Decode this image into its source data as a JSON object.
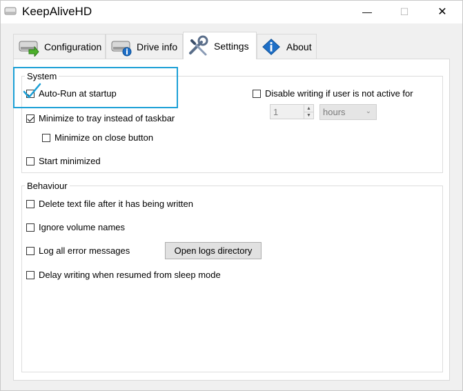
{
  "window": {
    "title": "KeepAliveHD"
  },
  "titlebar": {
    "minimize": "—",
    "maximize": "☐",
    "close": "✕"
  },
  "tabs": [
    {
      "label": "Configuration",
      "icon": "drive-arrow-icon",
      "active": false
    },
    {
      "label": "Drive info",
      "icon": "drive-info-icon",
      "active": false
    },
    {
      "label": "Settings",
      "icon": "wrench-screwdriver-icon",
      "active": true
    },
    {
      "label": "About",
      "icon": "info-icon",
      "active": false
    }
  ],
  "system": {
    "legend": "System",
    "autorun": {
      "label": "Auto-Run at startup",
      "checked": true
    },
    "minimize_tray": {
      "label": "Minimize to tray instead of taskbar",
      "checked": true
    },
    "minimize_close": {
      "label": "Minimize on close button",
      "checked": false
    },
    "start_minimized": {
      "label": "Start minimized",
      "checked": false
    },
    "disable_writing": {
      "label": "Disable writing if user is not active for",
      "checked": false
    },
    "inactive_value": "1",
    "inactive_unit": "hours"
  },
  "behaviour": {
    "legend": "Behaviour",
    "delete_text": {
      "label": "Delete text file after it has being written",
      "checked": false
    },
    "ignore_volume": {
      "label": "Ignore volume names",
      "checked": false
    },
    "log_errors": {
      "label": "Log all error messages",
      "checked": false
    },
    "open_logs_button": "Open logs directory",
    "delay_writing": {
      "label": "Delay writing when resumed from sleep mode",
      "checked": false
    }
  },
  "colors": {
    "highlight": "#1a9fd6",
    "panel_bg": "#ffffff",
    "window_bg": "#f0f0f0"
  }
}
